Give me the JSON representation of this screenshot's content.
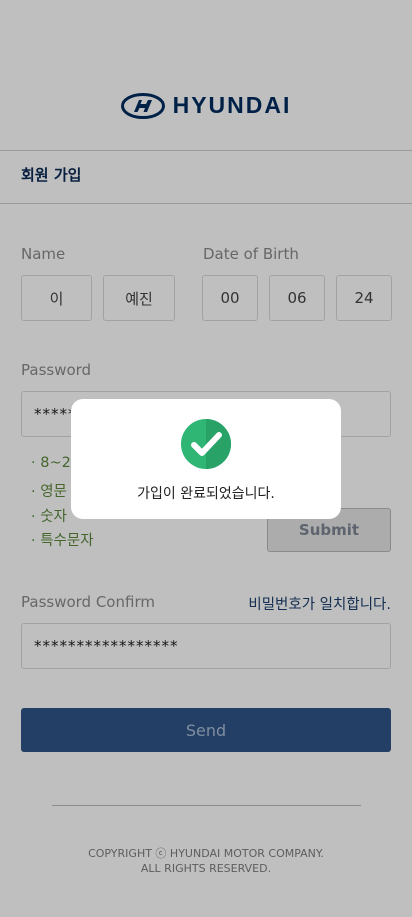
{
  "brand": {
    "name": "HYUNDAI",
    "color": "#002c5f"
  },
  "page_title": "회원 가입",
  "name_field": {
    "label": "Name",
    "last": "이",
    "first": "예진"
  },
  "dob_field": {
    "label": "Date of Birth",
    "year": "00",
    "month": "06",
    "day": "24"
  },
  "password_field": {
    "label": "Password",
    "value": "*****"
  },
  "password_rules": [
    "· 8~20",
    "· 영문",
    "· 숫자",
    "· 특수문자"
  ],
  "submit_label": "Submit",
  "confirm_field": {
    "label": "Password Confirm",
    "value": "*****************",
    "match_msg": "비밀번호가 일치합니다."
  },
  "send_label": "Send",
  "footer": {
    "line1": "COPYRIGHT ⓒ HYUNDAI MOTOR COMPANY.",
    "line2": "ALL RIGHTS RESERVED."
  },
  "modal": {
    "message": "가입이 완료되었습니다.",
    "icon": "check-circle-icon",
    "icon_color": "#2fb574"
  }
}
